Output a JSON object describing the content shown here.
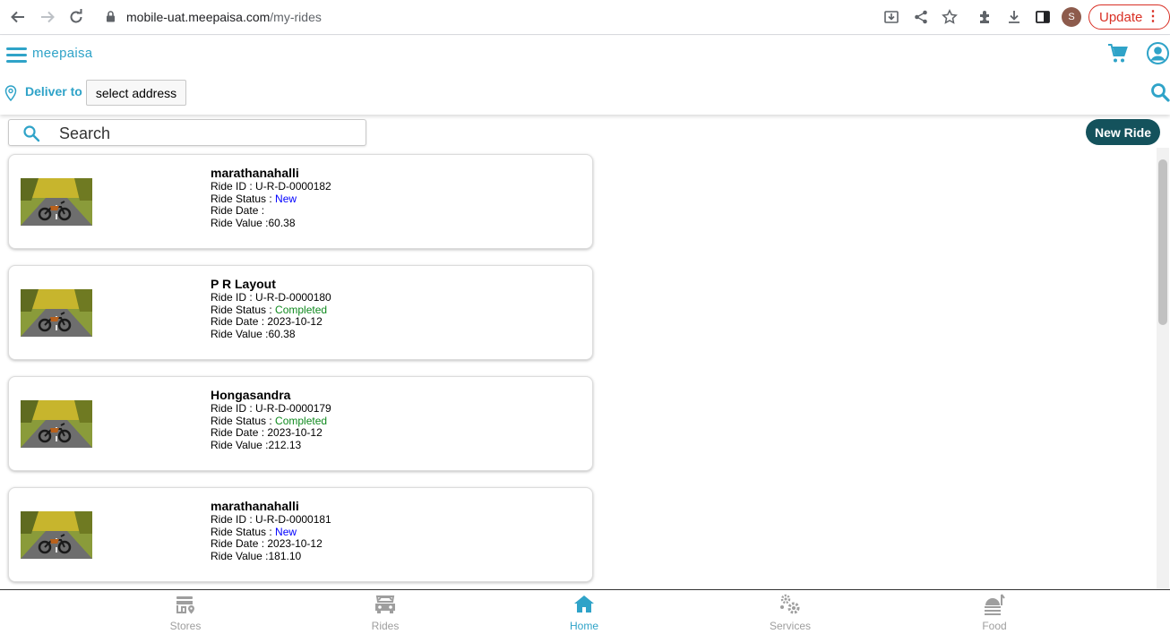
{
  "browser": {
    "url_host": "mobile-uat.meepaisa.com",
    "url_path": "/my-rides",
    "profile_initial": "S",
    "update_label": "Update"
  },
  "header": {
    "brand": "meepaisa",
    "deliver_label": "Deliver to",
    "address_button": "select address",
    "accent_color": "#2fa3c8"
  },
  "toolbar": {
    "search_placeholder": "Search",
    "new_ride_label": "New Ride",
    "new_ride_color": "#14525c"
  },
  "rides": [
    {
      "title": "marathanahalli",
      "id_label": "Ride ID :",
      "id": "U-R-D-0000182",
      "status_label": "Ride Status :",
      "status": "New",
      "status_type": "new",
      "date_label": "Ride Date :",
      "date": "",
      "value_label": "Ride Value :",
      "value": "60.38"
    },
    {
      "title": "P R Layout",
      "id_label": "Ride ID :",
      "id": "U-R-D-0000180",
      "status_label": "Ride Status :",
      "status": "Completed",
      "status_type": "completed",
      "date_label": "Ride Date :",
      "date": "2023-10-12",
      "value_label": "Ride Value :",
      "value": "60.38"
    },
    {
      "title": "Hongasandra",
      "id_label": "Ride ID :",
      "id": "U-R-D-0000179",
      "status_label": "Ride Status :",
      "status": "Completed",
      "status_type": "completed",
      "date_label": "Ride Date :",
      "date": "2023-10-12",
      "value_label": "Ride Value :",
      "value": "212.13"
    },
    {
      "title": "marathanahalli",
      "id_label": "Ride ID :",
      "id": "U-R-D-0000181",
      "status_label": "Ride Status :",
      "status": "New",
      "status_type": "new",
      "date_label": "Ride Date :",
      "date": "2023-10-12",
      "value_label": "Ride Value :",
      "value": "181.10"
    }
  ],
  "bottom_nav": {
    "items": [
      {
        "label": "Stores",
        "icon": "stores-icon",
        "active": false
      },
      {
        "label": "Rides",
        "icon": "car-icon",
        "active": false
      },
      {
        "label": "Home",
        "icon": "home-icon",
        "active": true
      },
      {
        "label": "Services",
        "icon": "gears-icon",
        "active": false
      },
      {
        "label": "Food",
        "icon": "food-icon",
        "active": false
      }
    ]
  }
}
